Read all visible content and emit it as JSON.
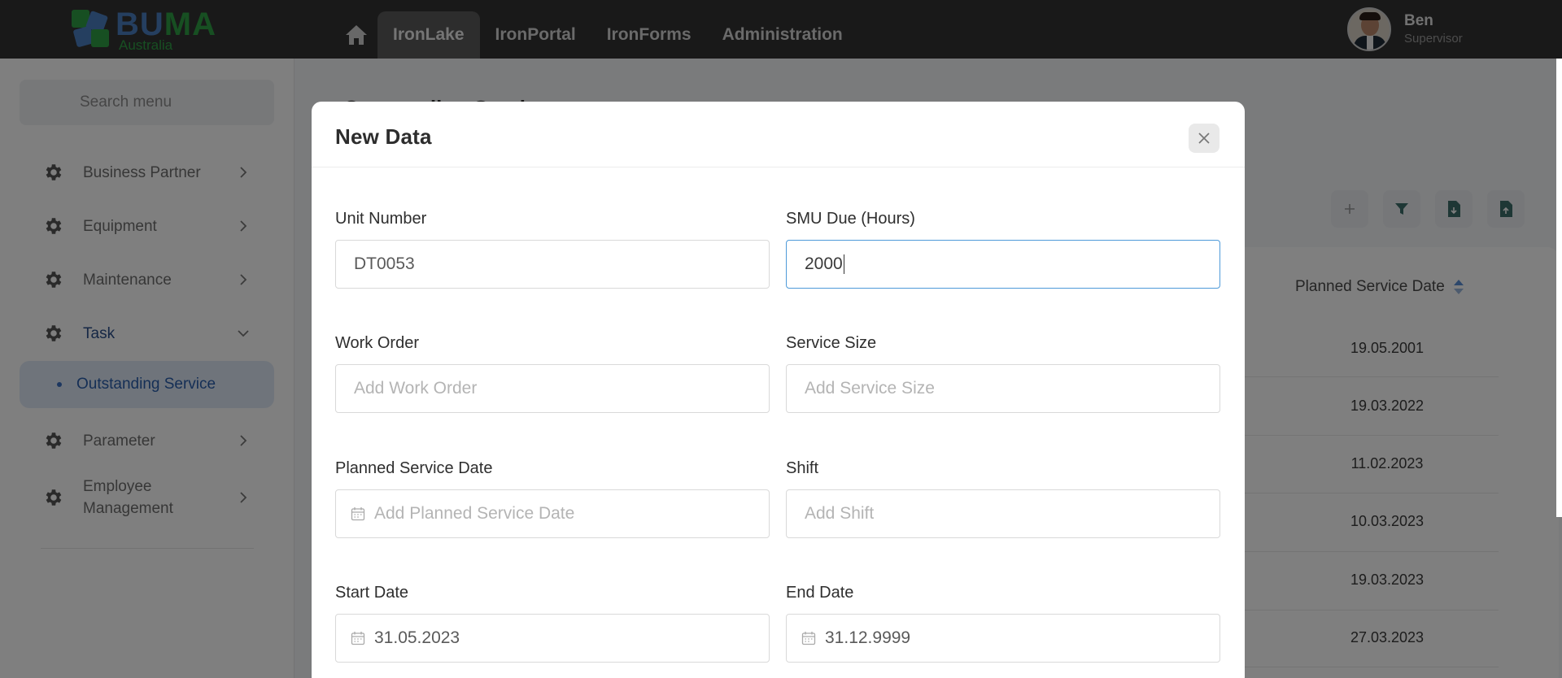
{
  "brand": {
    "title_a": "BU",
    "title_b": "MA",
    "subtitle": "Australia",
    "colors": {
      "blue": "#4a7fc1",
      "green": "#2f9e44"
    }
  },
  "nav": {
    "home_icon": "home-icon",
    "items": [
      {
        "label": "IronLake",
        "active": true
      },
      {
        "label": "IronPortal",
        "active": false
      },
      {
        "label": "IronForms",
        "active": false
      },
      {
        "label": "Administration",
        "active": false
      }
    ]
  },
  "user": {
    "name": "Ben",
    "role": "Supervisor"
  },
  "sidebar": {
    "search_placeholder": "Search menu",
    "items": [
      {
        "label": "Business Partner",
        "icon": "gear-icon"
      },
      {
        "label": "Equipment",
        "icon": "gear-icon"
      },
      {
        "label": "Maintenance",
        "icon": "gear-icon"
      },
      {
        "label": "Task",
        "icon": "gear-icon",
        "expanded": true
      },
      {
        "label": "Parameter",
        "icon": "gear-icon"
      },
      {
        "label": "Employee Management",
        "icon": "gear-icon"
      }
    ],
    "submenu": {
      "label": "Outstanding Service",
      "active": true
    }
  },
  "main": {
    "page_title": "Outstanding Service",
    "toolbar_icons": [
      "plus-icon",
      "filter-icon",
      "file-import-icon",
      "file-upload-icon"
    ],
    "table": {
      "column": "Planned Service Date",
      "rows": [
        "19.05.2001",
        "19.03.2022",
        "11.02.2023",
        "10.03.2023",
        "19.03.2023",
        "27.03.2023"
      ]
    }
  },
  "modal": {
    "title": "New Data",
    "close_icon": "close-icon",
    "fields": {
      "unit_number": {
        "label": "Unit Number",
        "value": "DT0053"
      },
      "smu_due": {
        "label": "SMU Due (Hours)",
        "value": "2000"
      },
      "work_order": {
        "label": "Work Order",
        "placeholder": "Add Work Order"
      },
      "service_size": {
        "label": "Service Size",
        "placeholder": "Add Service Size"
      },
      "planned_service_date": {
        "label": "Planned Service Date",
        "placeholder": "Add Planned Service Date"
      },
      "shift": {
        "label": "Shift",
        "placeholder": "Add Shift"
      },
      "start_date": {
        "label": "Start Date",
        "value": "31.05.2023"
      },
      "end_date": {
        "label": "End Date",
        "value": "31.12.9999"
      }
    }
  }
}
